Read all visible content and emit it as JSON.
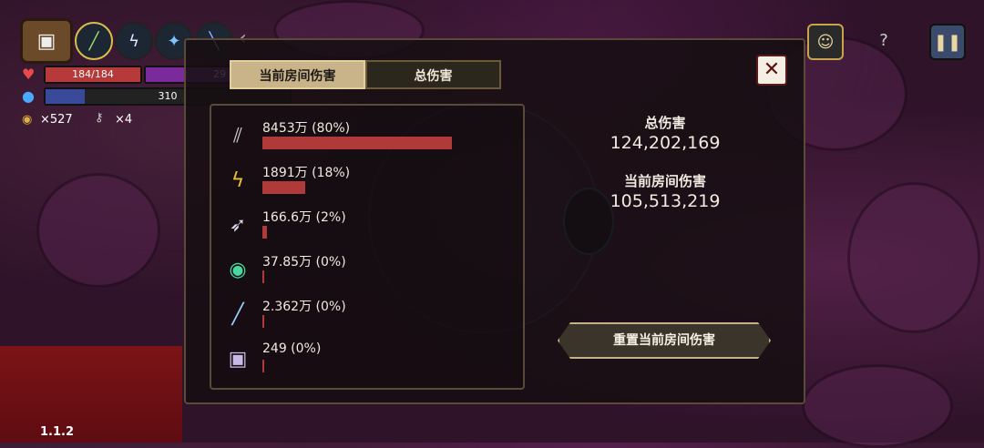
{
  "hud": {
    "hp_text": "184/184",
    "hp_fraction": 1.0,
    "shield_text": "29",
    "mana_text": "310",
    "mana_fraction": 0.16,
    "coins": "×527",
    "keys": "×4",
    "weapon_icons": [
      "staff-icon",
      "lightning-icon",
      "crystal-icon",
      "rifle-icon"
    ]
  },
  "tabs": {
    "current_room": "当前房间伤害",
    "total": "总伤害"
  },
  "damage_rows": [
    {
      "icon": "blades-icon",
      "label": "8453万 (80%)",
      "fraction": 0.8
    },
    {
      "icon": "lightning-bolt-icon",
      "label": "1891万 (18%)",
      "fraction": 0.18
    },
    {
      "icon": "spike-icon",
      "label": "166.6万 (2%)",
      "fraction": 0.02
    },
    {
      "icon": "green-orb-icon",
      "label": "37.85万 (0%)",
      "fraction": 0.0
    },
    {
      "icon": "ice-shard-icon",
      "label": "2.362万 (0%)",
      "fraction": 0.0
    },
    {
      "icon": "rune-box-icon",
      "label": "249 (0%)",
      "fraction": 0.0
    }
  ],
  "stats": {
    "total_label": "总伤害",
    "total_value": "124,202,169",
    "room_label": "当前房间伤害",
    "room_value": "105,513,219"
  },
  "reset_button": "重置当前房间伤害",
  "close_symbol": "✕",
  "version": "1.1.2",
  "colors": {
    "hp": "#b73a3a",
    "shield": "#7a2a9a",
    "mana": "#3a4a9a",
    "damage_bar": "#b03a3a",
    "tab_active": "#c9b48a"
  }
}
